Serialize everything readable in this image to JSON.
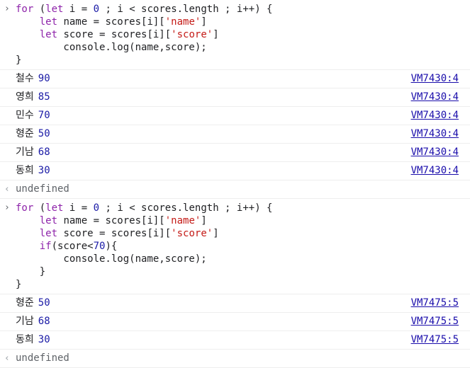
{
  "blocks": [
    {
      "prompt": "›",
      "code": {
        "l1": {
          "kw_for": "for",
          "paren": " (",
          "kw_let": "let",
          "a": " i = ",
          "n0": "0",
          "b": " ; i < scores.length ; i++) {"
        },
        "l2": {
          "indent": "    ",
          "kw_let": "let",
          "a": " name = scores[i][",
          "s": "'name'",
          "b": "]"
        },
        "l3": {
          "indent": "    ",
          "kw_let": "let",
          "a": " score = scores[i][",
          "s": "'score'",
          "b": "]"
        },
        "l4": {
          "text": "        console.log(name,score);"
        },
        "l5": {
          "text": "}"
        }
      },
      "logs": [
        {
          "name": "철수",
          "score": "90",
          "source": "VM7430:4"
        },
        {
          "name": "영희",
          "score": "85",
          "source": "VM7430:4"
        },
        {
          "name": "민수",
          "score": "70",
          "source": "VM7430:4"
        },
        {
          "name": "형준",
          "score": "50",
          "source": "VM7430:4"
        },
        {
          "name": "기남",
          "score": "68",
          "source": "VM7430:4"
        },
        {
          "name": "동희",
          "score": "30",
          "source": "VM7430:4"
        }
      ],
      "result_arrow": "‹",
      "result": "undefined"
    },
    {
      "prompt": "›",
      "code": {
        "l1": {
          "kw_for": "for",
          "paren": " (",
          "kw_let": "let",
          "a": " i = ",
          "n0": "0",
          "b": " ; i < scores.length ; i++) {"
        },
        "l2": {
          "indent": "    ",
          "kw_let": "let",
          "a": " name = scores[i][",
          "s": "'name'",
          "b": "]"
        },
        "l3": {
          "indent": "    ",
          "kw_let": "let",
          "a": " score = scores[i][",
          "s": "'score'",
          "b": "]"
        },
        "l4": {
          "indent": "    ",
          "kw_if": "if",
          "a": "(score<",
          "n": "70",
          "b": "){"
        },
        "l5": {
          "text": "        console.log(name,score);"
        },
        "l6": {
          "text": "    }"
        },
        "l7": {
          "text": "}"
        }
      },
      "logs": [
        {
          "name": "형준",
          "score": "50",
          "source": "VM7475:5"
        },
        {
          "name": "기남",
          "score": "68",
          "source": "VM7475:5"
        },
        {
          "name": "동희",
          "score": "30",
          "source": "VM7475:5"
        }
      ],
      "result_arrow": "‹",
      "result": "undefined"
    }
  ],
  "colors": {
    "keyword": "#8e24aa",
    "number": "#1a1aa6",
    "string": "#c41a16",
    "link": "#1a0dab",
    "separator": "#eeeeee"
  }
}
